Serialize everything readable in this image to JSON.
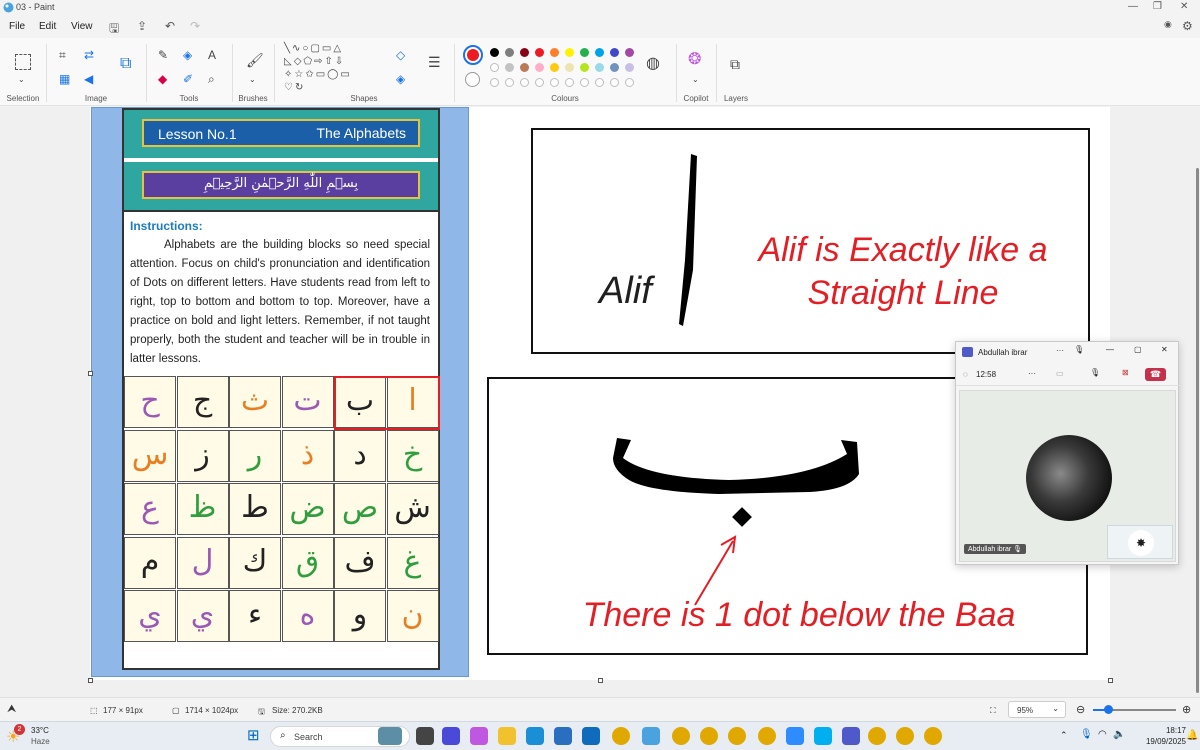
{
  "window": {
    "title": "03 - Paint"
  },
  "menu": {
    "file": "File",
    "edit": "Edit",
    "view": "View"
  },
  "ribbon": {
    "groups": {
      "selection": "Selection",
      "image": "Image",
      "tools": "Tools",
      "brushes": "Brushes",
      "shapes": "Shapes",
      "colours": "Colours",
      "copilot": "Copilot",
      "layers": "Layers"
    },
    "palette_row1": [
      "#000000",
      "#7f7f7f",
      "#880015",
      "#ed1c24",
      "#ff7f27",
      "#fff200",
      "#22b14c",
      "#00a2e8",
      "#3f48cc",
      "#a349a4"
    ],
    "palette_row2": [
      "#ffffff",
      "#c3c3c3",
      "#b97a57",
      "#ffaec9",
      "#ffc90e",
      "#efe4b0",
      "#b5e61d",
      "#99d9ea",
      "#7092be",
      "#c8bfe7"
    ],
    "primary_color": "#ed1c24"
  },
  "poster": {
    "lesson": "Lesson No.1",
    "topic": "The Alphabets",
    "bismillah": "بِسۡمِ اللّٰهِ الرَّحۡمٰنِ الرَّحِيۡمِ",
    "instructions_heading": "Instructions:",
    "instructions_text": "Alphabets are the building blocks so need special attention. Focus on child's pronunciation and identification of Dots on different letters. Have students read from left to right, top to bottom and bottom to top. Moreover, have a practice on bold and light letters. Remember, if not taught properly, both the student and teacher will be in trouble in latter lessons.",
    "rows": [
      [
        "ح",
        "ج",
        "ث",
        "ت",
        "ب",
        "ا"
      ],
      [
        "س",
        "ز",
        "ر",
        "ذ",
        "د",
        "خ"
      ],
      [
        "ع",
        "ظ",
        "ط",
        "ض",
        "ص",
        "ش"
      ],
      [
        "م",
        "ل",
        "ك",
        "ق",
        "ف",
        "غ"
      ],
      [
        "ي",
        "ي",
        "ء",
        "ه",
        "و",
        "ن"
      ]
    ]
  },
  "alif_panel": {
    "label": "Alif",
    "letter": "ا",
    "caption_line1": "Alif is Exactly like a",
    "caption_line2": "Straight Line"
  },
  "baa_panel": {
    "letter": "ب",
    "caption": "There is 1 dot below the Baa"
  },
  "call": {
    "name": "Abdullah ibrar",
    "timer": "12:58",
    "tile_name": "Abdullah ibrar"
  },
  "status": {
    "selection_size": "177 × 91px",
    "canvas_size": "1714 × 1024px",
    "file_size": "Size: 270.2KB",
    "zoom": "95%"
  },
  "taskbar": {
    "temp": "33°C",
    "weather": "Haze",
    "search": "Search",
    "time": "18:17",
    "date": "19/09/2025",
    "weather_badge": "2"
  }
}
